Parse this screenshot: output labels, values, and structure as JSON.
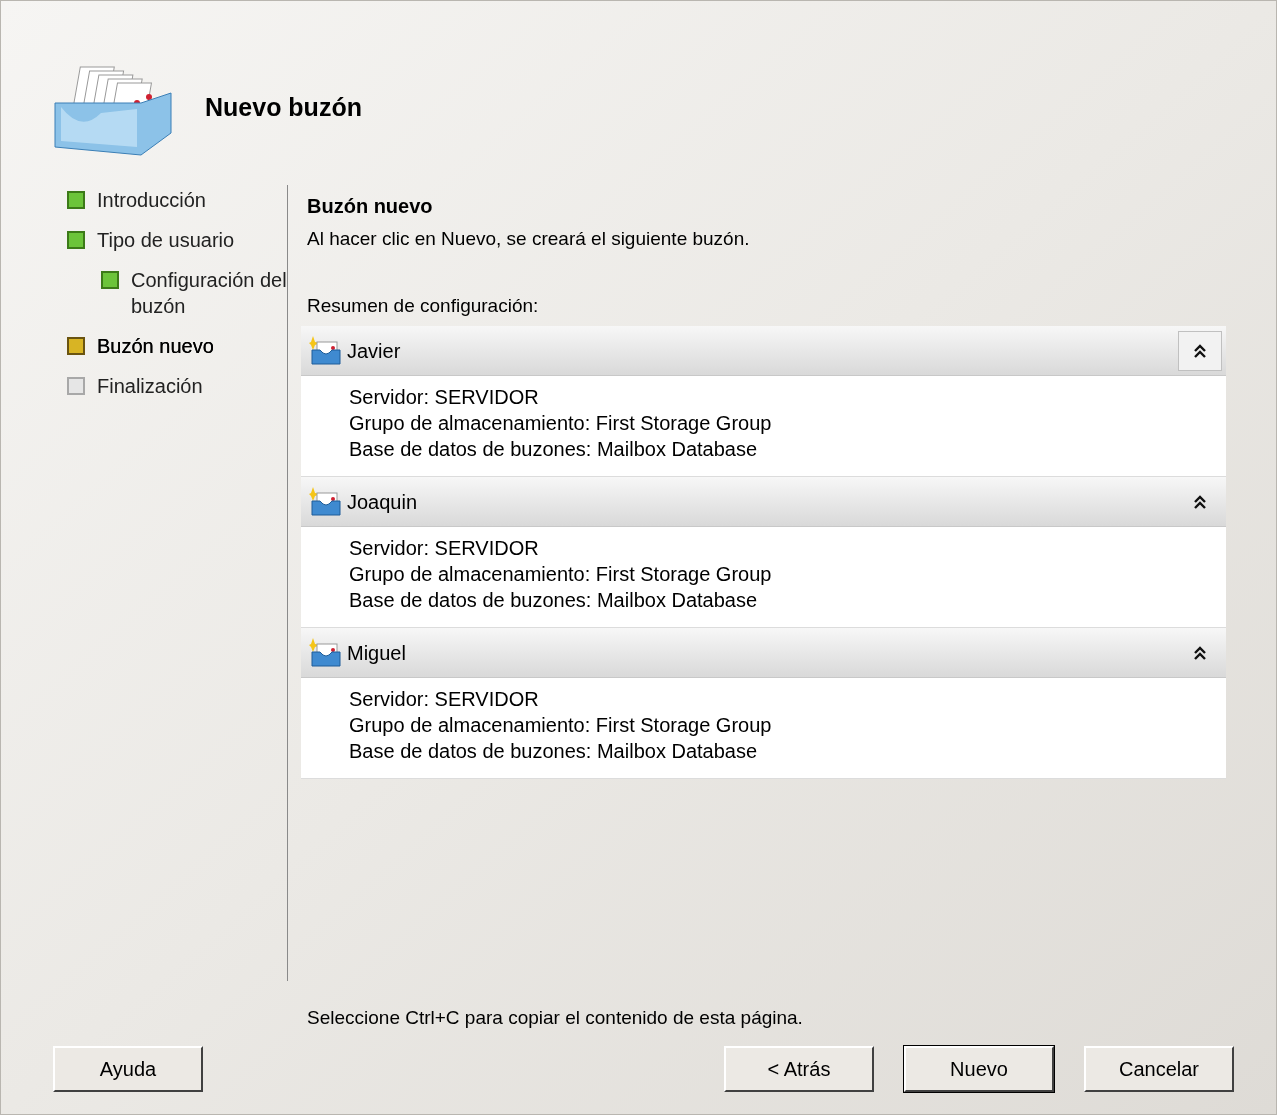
{
  "header": {
    "title": "Nuevo buzón"
  },
  "steps": [
    {
      "label": "Introducción",
      "completed": true,
      "selected": false
    },
    {
      "label": "Tipo de usuario",
      "completed": true,
      "selected": false,
      "children": [
        {
          "label": "Configuración del buzón",
          "completed": true,
          "selected": false
        }
      ]
    },
    {
      "label": "Buzón nuevo",
      "completed": false,
      "selected": true
    },
    {
      "label": "Finalización",
      "completed": false,
      "selected": false
    }
  ],
  "page": {
    "title": "Buzón nuevo",
    "description": "Al hacer clic en Nuevo, se creará el siguiente buzón.",
    "summary_label": "Resumen de configuración:",
    "sections": [
      {
        "name": "Javier",
        "expanded": true,
        "lines": [
          "Servidor: SERVIDOR",
          "Grupo de almacenamiento: First Storage Group",
          "Base de datos de buzones: Mailbox Database"
        ]
      },
      {
        "name": "Joaquin",
        "expanded": true,
        "lines": [
          "Servidor: SERVIDOR",
          "Grupo de almacenamiento: First Storage Group",
          "Base de datos de buzones: Mailbox Database"
        ]
      },
      {
        "name": "Miguel",
        "expanded": true,
        "lines": [
          "Servidor: SERVIDOR",
          "Grupo de almacenamiento: First Storage Group",
          "Base de datos de buzones: Mailbox Database"
        ]
      }
    ],
    "footer_note": "Seleccione Ctrl+C para copiar el contenido de esta página."
  },
  "buttons": {
    "left": [
      {
        "label": "Ayuda",
        "default": false
      }
    ],
    "right": [
      {
        "label": "< Atrás",
        "default": false
      },
      {
        "label": "Nuevo",
        "default": true
      },
      {
        "label": "Cancelar",
        "default": false
      }
    ]
  }
}
